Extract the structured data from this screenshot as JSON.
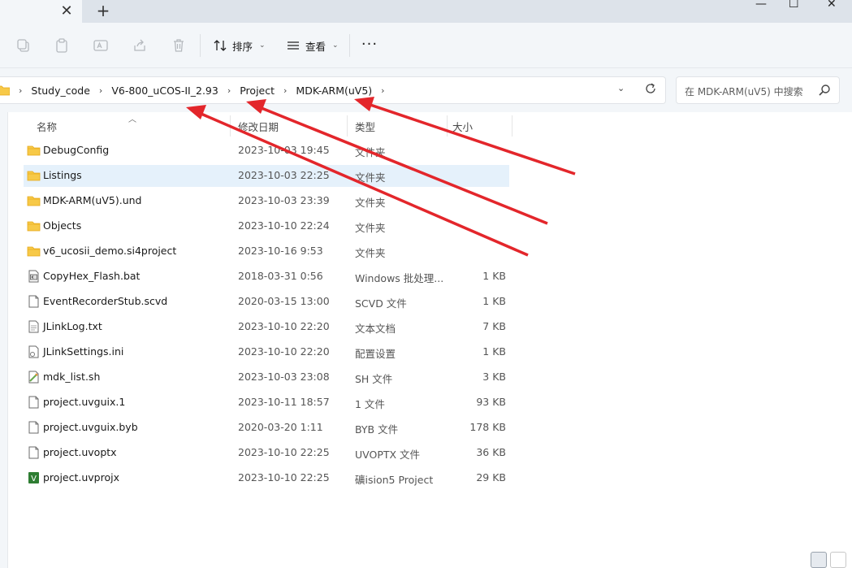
{
  "tabs": {
    "close_glyph": "✕",
    "new_glyph": "+"
  },
  "window": {
    "minimize_glyph": "—",
    "maximize_glyph": "☐",
    "close_glyph": "✕"
  },
  "toolbar": {
    "sort_label": "排序",
    "view_label": "查看",
    "more_glyph": "···",
    "chevron": "⌄"
  },
  "address": {
    "crumbs": [
      "Study_code",
      "V6-800_uCOS-II_2.93",
      "Project",
      "MDK-ARM(uV5)"
    ],
    "separator": "›"
  },
  "search": {
    "placeholder": "在 MDK-ARM(uV5) 中搜索"
  },
  "columns": {
    "name": "名称",
    "date": "修改日期",
    "type": "类型",
    "size": "大小"
  },
  "files": [
    {
      "icon": "folder",
      "name": "DebugConfig",
      "date": "2023-10-03 19:45",
      "type": "文件夹",
      "size": ""
    },
    {
      "icon": "folder",
      "name": "Listings",
      "date": "2023-10-03 22:25",
      "type": "文件夹",
      "size": "",
      "selected": true
    },
    {
      "icon": "folder",
      "name": "MDK-ARM(uV5).und",
      "date": "2023-10-03 23:39",
      "type": "文件夹",
      "size": ""
    },
    {
      "icon": "folder",
      "name": "Objects",
      "date": "2023-10-10 22:24",
      "type": "文件夹",
      "size": ""
    },
    {
      "icon": "folder",
      "name": "v6_ucosii_demo.si4project",
      "date": "2023-10-16 9:53",
      "type": "文件夹",
      "size": ""
    },
    {
      "icon": "bat",
      "name": "CopyHex_Flash.bat",
      "date": "2018-03-31 0:56",
      "type": "Windows 批处理...",
      "size": "1 KB"
    },
    {
      "icon": "file",
      "name": "EventRecorderStub.scvd",
      "date": "2020-03-15 13:00",
      "type": "SCVD 文件",
      "size": "1 KB"
    },
    {
      "icon": "txt",
      "name": "JLinkLog.txt",
      "date": "2023-10-10 22:20",
      "type": "文本文档",
      "size": "7 KB"
    },
    {
      "icon": "ini",
      "name": "JLinkSettings.ini",
      "date": "2023-10-10 22:20",
      "type": "配置设置",
      "size": "1 KB"
    },
    {
      "icon": "sh",
      "name": "mdk_list.sh",
      "date": "2023-10-03 23:08",
      "type": "SH 文件",
      "size": "3 KB"
    },
    {
      "icon": "file",
      "name": "project.uvguix.1",
      "date": "2023-10-11 18:57",
      "type": "1 文件",
      "size": "93 KB"
    },
    {
      "icon": "file",
      "name": "project.uvguix.byb",
      "date": "2020-03-20 1:11",
      "type": "BYB 文件",
      "size": "178 KB"
    },
    {
      "icon": "file",
      "name": "project.uvoptx",
      "date": "2023-10-10 22:25",
      "type": "UVOPTX 文件",
      "size": "36 KB"
    },
    {
      "icon": "uvprojx",
      "name": "project.uvprojx",
      "date": "2023-10-10 22:25",
      "type": "礦ision5 Project",
      "size": "29 KB"
    }
  ],
  "colors": {
    "folder": "#f7c948",
    "folder_dark": "#e6a817",
    "arrow": "#e3262b",
    "selected_row": "#e5f1fb",
    "uvision_green": "#2e7d32"
  }
}
